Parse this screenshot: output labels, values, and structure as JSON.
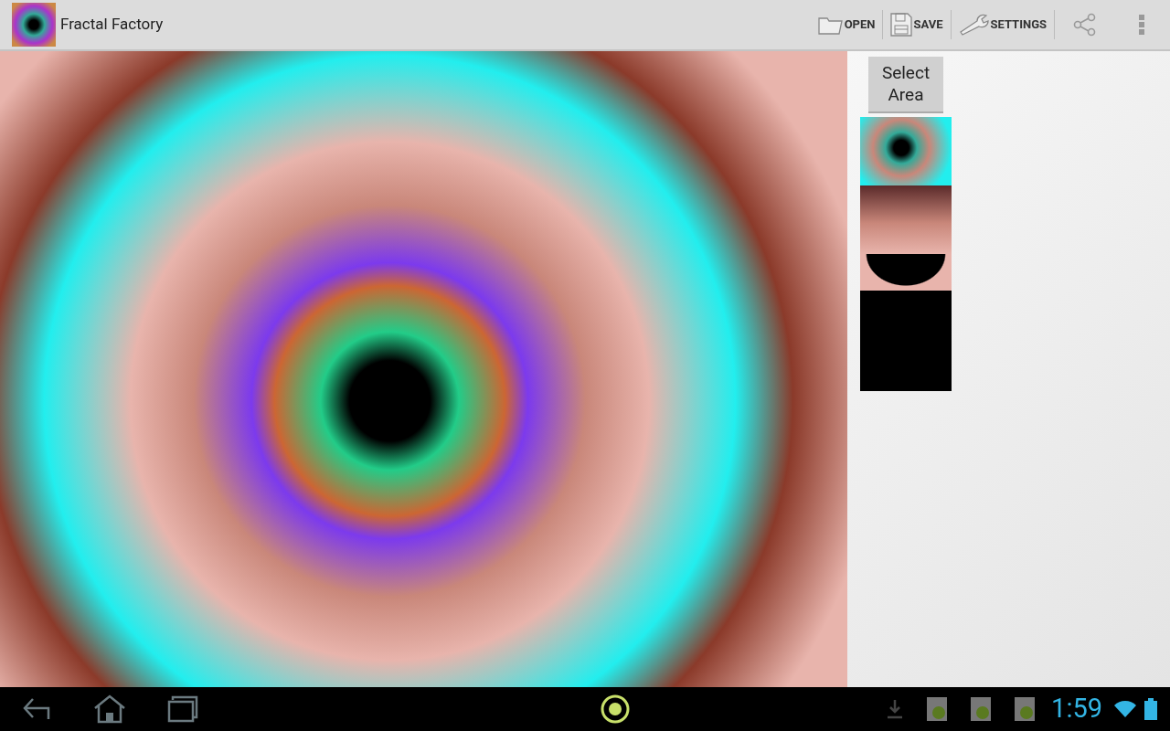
{
  "action_bar": {
    "title": "Fractal Factory",
    "actions": [
      {
        "kind": "folder",
        "label": "OPEN"
      },
      {
        "kind": "disk",
        "label": "SAVE"
      },
      {
        "kind": "wrench",
        "label": "SETTINGS"
      }
    ]
  },
  "side_panel": {
    "select_button": "Select Area"
  },
  "status_bar": {
    "time": "1:59"
  }
}
